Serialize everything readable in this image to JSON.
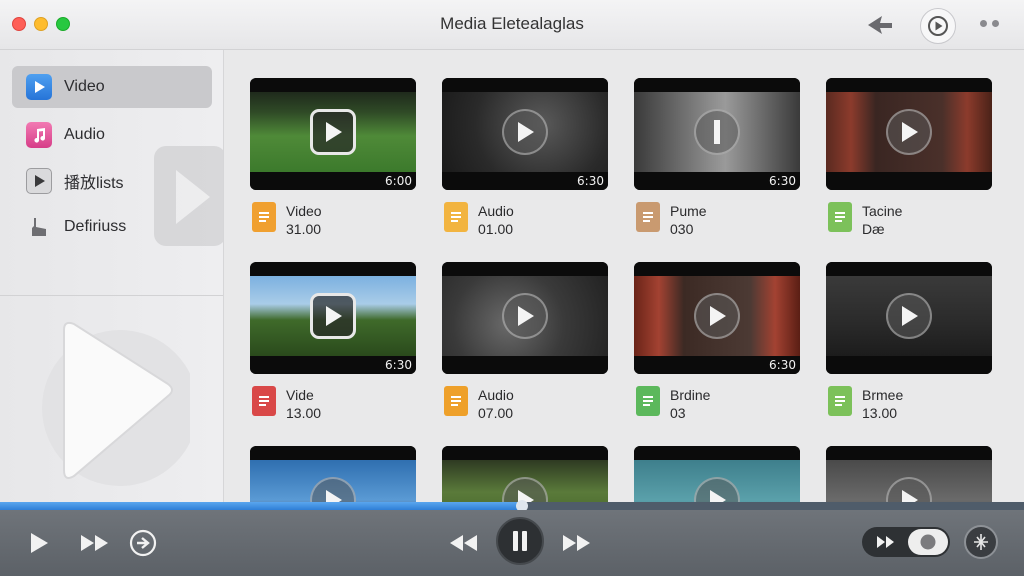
{
  "window": {
    "title": "Media Eletealaglas",
    "colors": {
      "accent": "#2f7fd6",
      "sidebar_active": "#c9c9cc",
      "controlbar": "#5f6469"
    }
  },
  "toolbar": {
    "icons": [
      "back-arrow-icon",
      "play-circle-icon",
      "more-dots-icon"
    ]
  },
  "sidebar": {
    "items": [
      {
        "label": "Video",
        "icon": "video-icon",
        "active": true
      },
      {
        "label": "Audio",
        "icon": "music-note-icon",
        "active": false
      },
      {
        "label": "播放lists",
        "icon": "playlist-icon",
        "active": false
      },
      {
        "label": "Defiriuss",
        "icon": "hand-icon",
        "active": false
      }
    ]
  },
  "media": {
    "items": [
      {
        "title": "Video",
        "sub": "31.00",
        "duration": "6:00",
        "file_icon": "orange-doc-icon",
        "thumb": "field"
      },
      {
        "title": "Audio",
        "sub": "01.00",
        "duration": "6:30",
        "file_icon": "yellow-doc-icon",
        "thumb": "dark"
      },
      {
        "title": "Pume",
        "sub": "030",
        "duration": "6:30",
        "file_icon": "tan-doc-icon",
        "thumb": "gray-pause"
      },
      {
        "title": "Tacine",
        "sub": "Dæ",
        "duration": "",
        "file_icon": "green-doc-icon",
        "thumb": "red-room"
      },
      {
        "title": "Vide",
        "sub": "13.00",
        "duration": "6:30",
        "file_icon": "red-music-icon",
        "thumb": "tree"
      },
      {
        "title": "Audio",
        "sub": "07.00",
        "duration": "",
        "file_icon": "orange-disc-icon",
        "thumb": "desk"
      },
      {
        "title": "Brdine",
        "sub": "03",
        "duration": "6:30",
        "file_icon": "green-tool-icon",
        "thumb": "red-stage"
      },
      {
        "title": "Brmee",
        "sub": "13.00",
        "duration": "",
        "file_icon": "green-doc-icon",
        "thumb": "studio"
      },
      {
        "title": "",
        "sub": "",
        "duration": "",
        "file_icon": "",
        "thumb": "blue-sky"
      },
      {
        "title": "",
        "sub": "",
        "duration": "",
        "file_icon": "",
        "thumb": "greenery"
      },
      {
        "title": "",
        "sub": "",
        "duration": "",
        "file_icon": "",
        "thumb": "teal-camera"
      },
      {
        "title": "",
        "sub": "",
        "duration": "",
        "file_icon": "",
        "thumb": "gray-room"
      }
    ]
  },
  "player": {
    "progress": 0.51,
    "controls": [
      "play-icon",
      "fast-forward-icon",
      "forward-circle-icon",
      "rewind-icon",
      "pause-icon",
      "next-icon",
      "speed-toggle-icon",
      "share-circle-icon"
    ]
  }
}
